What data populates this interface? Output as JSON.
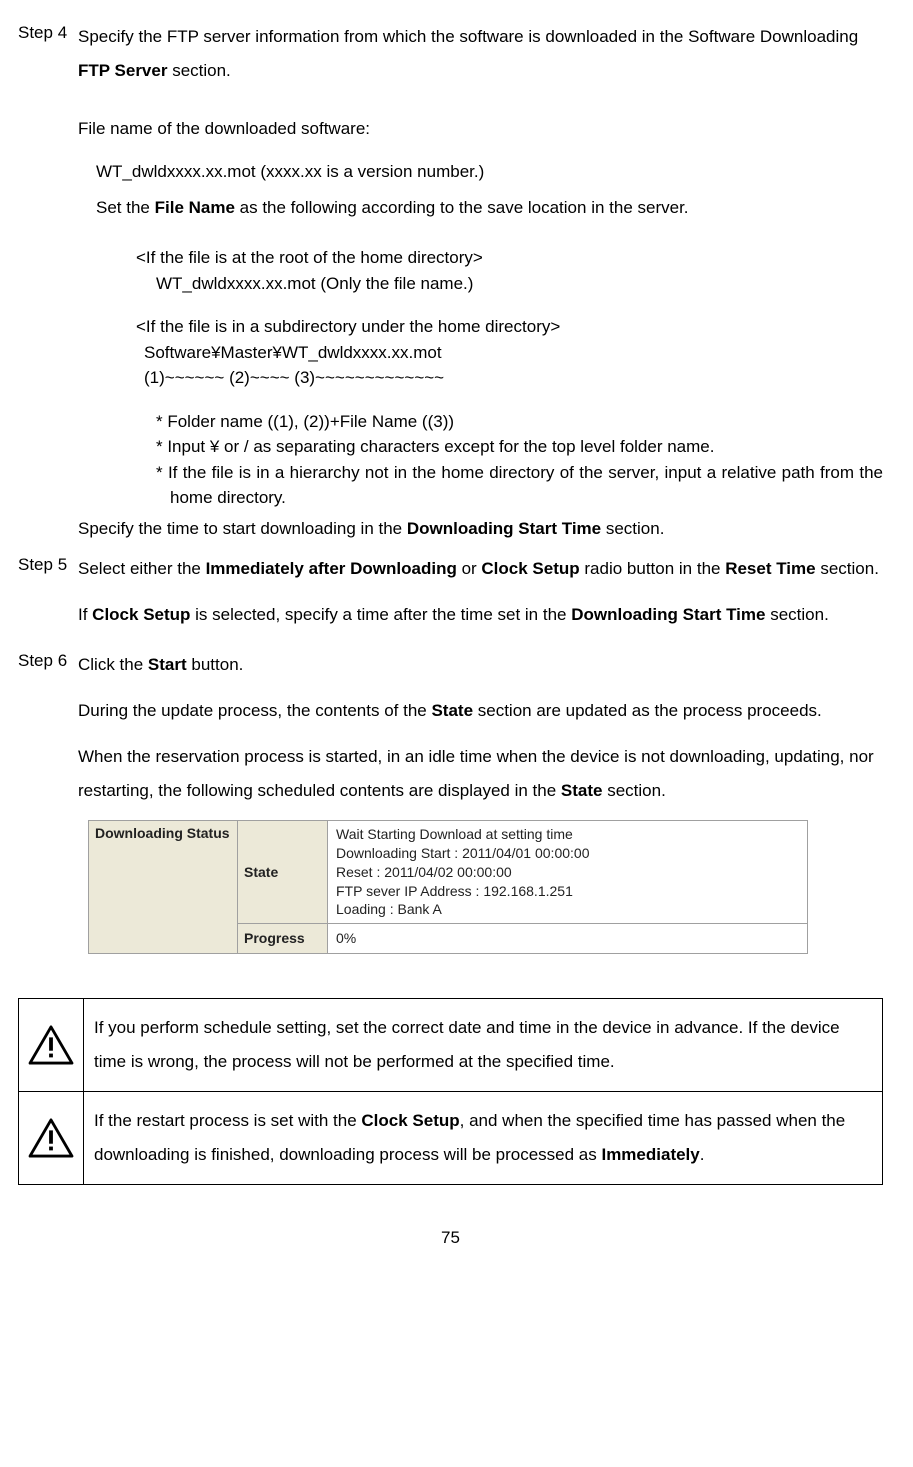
{
  "page_number": "75",
  "step4": {
    "label": "Step 4",
    "p1_a": "Specify the FTP server information from which the software is downloaded in the Software Downloading ",
    "p1_b": "FTP Server",
    "p1_c": " section.",
    "p2": "File name of the downloaded software:",
    "p3": "WT_dwldxxxx.xx.mot (xxxx.xx is a version number.)",
    "p4_a": "Set the ",
    "p4_b": "File Name",
    "p4_c": " as the following according to the save location in the server.",
    "blk1_l1": "<If the file is at the root of the home directory>",
    "blk1_l2": "WT_dwldxxxx.xx.mot (Only the file name.)",
    "blk2_l1": "<If the file is in a subdirectory under the home directory>",
    "blk2_l2": "Software¥Master¥WT_dwldxxxx.xx.mot",
    "blk2_l3": "(1)~~~~~~ (2)~~~~ (3)~~~~~~~~~~~~~",
    "note1": "* Folder name    ((1), (2))+File Name ((3))",
    "note2": "* Input ¥ or / as separating characters except for the top level folder name.",
    "note3": "* If the file is in a hierarchy not in the home directory of the server, input a relative path from the home directory.",
    "p5_a": "Specify the time to start downloading in the ",
    "p5_b": "Downloading Start Time",
    "p5_c": " section."
  },
  "step5": {
    "label": "Step 5",
    "p1_a": "Select either the ",
    "p1_b": "Immediately after Downloading",
    "p1_c": " or ",
    "p1_d": "Clock Setup",
    "p1_e": " radio button in the ",
    "p1_f": "Reset Time",
    "p1_g": " section.",
    "p2_a": "If ",
    "p2_b": "Clock Setup",
    "p2_c": " is selected, specify a time after the time set in the ",
    "p2_d": "Downloading Start Time",
    "p2_e": " section."
  },
  "step6": {
    "label": "Step 6",
    "p1_a": "Click the ",
    "p1_b": "Start",
    "p1_c": " button.",
    "p2_a": "During the update process, the contents of the ",
    "p2_b": "State",
    "p2_c": " section are updated as the process proceeds.",
    "p3_a": "When the reservation process is started, in an idle time when the device is not downloading, updating, nor restarting, the following scheduled contents are displayed in the ",
    "p3_b": "State",
    "p3_c": " section."
  },
  "status": {
    "left_label": "Downloading Status",
    "state_label": "State",
    "progress_label": "Progress",
    "state_l1": "Wait Starting Download at setting time",
    "state_l2": "Downloading Start : 2011/04/01 00:00:00",
    "state_l3": "Reset : 2011/04/02 00:00:00",
    "state_l4": "FTP sever IP Address : 192.168.1.251",
    "state_l5": "Loading : Bank A",
    "progress_value": "0%"
  },
  "caution1": "If you perform schedule setting, set the correct date and time in the device in advance. If the device time is wrong, the process will not be performed at the specified time.",
  "caution2_a": "If the restart process is set with the ",
  "caution2_b": "Clock Setup",
  "caution2_c": ", and when the specified time has passed when the downloading is finished, downloading process will be processed as ",
  "caution2_d": "Immediately",
  "caution2_e": "."
}
